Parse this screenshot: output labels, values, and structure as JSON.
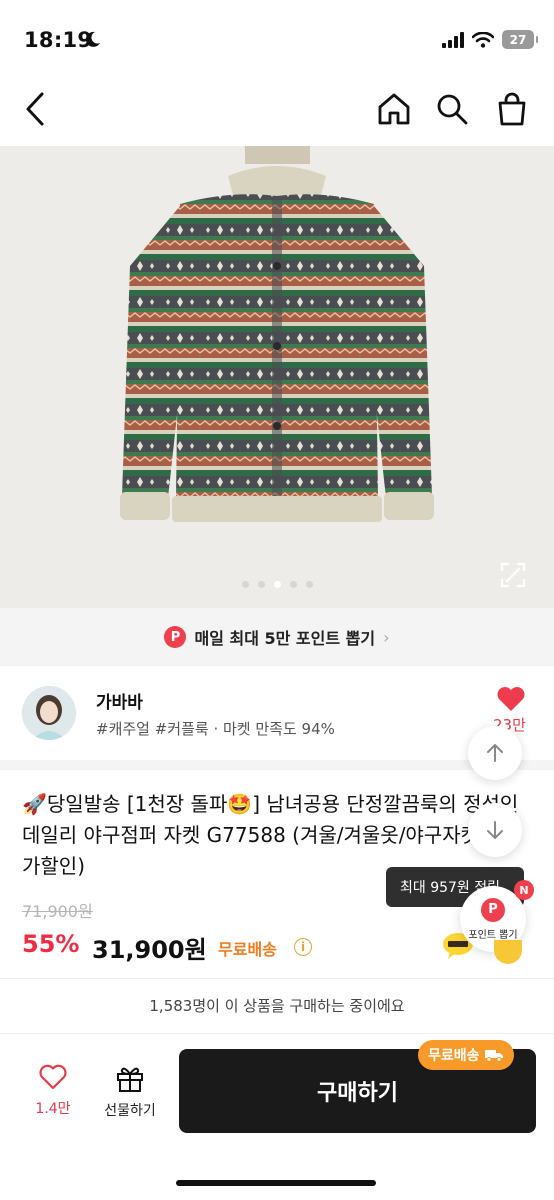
{
  "status": {
    "time": "18:19",
    "battery": "27"
  },
  "banner": {
    "point_icon": "P",
    "text": "매일 최대 5만 포인트 뽑기"
  },
  "seller": {
    "name": "가바바",
    "tags": "#캐주얼 #커플룩 · 마켓 만족도 94%",
    "likes": "23만"
  },
  "product": {
    "title": "🚀당일발송 [1천장 돌파🤩] 남녀공용 단정깔끔룩의 정석인 데일리 야구점퍼 자켓 G77588 (겨울/겨울옷/야구자켓/특가할인)",
    "original_price": "71,900원",
    "discount": "55%",
    "price": "31,900원",
    "shipping": "무료배송",
    "info_icon": "i"
  },
  "floating": {
    "tooltip": "최대 957원 적립",
    "point_icon": "P",
    "point_label": "포인트 뽑기",
    "badge": "N"
  },
  "buyers_text": "1,583명이 이 상품을 구매하는 중이에요",
  "bottom": {
    "like_count": "1.4만",
    "gift_label": "선물하기",
    "buy_label": "구매하기",
    "ship_badge": "무료배송"
  },
  "icons": [
    "moon-icon",
    "signal-icon",
    "wifi-icon",
    "battery-icon",
    "back-icon",
    "home-icon",
    "search-icon",
    "bag-icon",
    "expand-icon",
    "heart-icon",
    "arrow-up-icon",
    "arrow-down-icon",
    "talk-icon",
    "gift-icon",
    "truck-icon"
  ],
  "colors": {
    "accent_red": "#ee2d44",
    "shipping_orange": "#f07c20",
    "buy_button": "#1a1a1a"
  }
}
